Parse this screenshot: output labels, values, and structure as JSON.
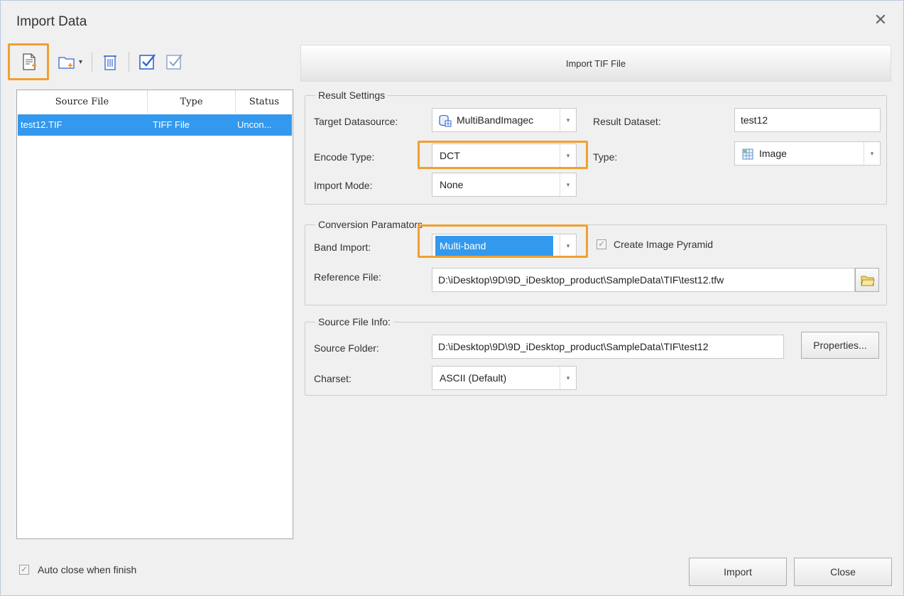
{
  "window": {
    "title": "Import Data",
    "close_glyph": "✕"
  },
  "toolbar": {
    "items": [
      {
        "name": "add-file-icon"
      },
      {
        "name": "add-folder-icon"
      },
      {
        "name": "delete-icon"
      },
      {
        "name": "select-all-icon"
      },
      {
        "name": "invert-selection-icon"
      }
    ],
    "dropdown_glyph": "▾"
  },
  "file_list": {
    "columns": [
      "Source File",
      "Type",
      "Status"
    ],
    "rows": [
      {
        "source_file": "test12.TIF",
        "type": "TIFF File",
        "status": "Uncon..."
      }
    ]
  },
  "panel": {
    "header": "Import TIF File"
  },
  "result_settings": {
    "legend": "Result Settings",
    "target_datasource_label": "Target Datasource:",
    "target_datasource_value": "MultiBandImagec",
    "result_dataset_label": "Result Dataset:",
    "result_dataset_value": "test12",
    "encode_type_label": "Encode Type:",
    "encode_type_value": "DCT",
    "type_label": "Type:",
    "type_value": "Image",
    "import_mode_label": "Import Mode:",
    "import_mode_value": "None"
  },
  "conversion": {
    "legend": "Conversion Paramators",
    "band_import_label": "Band Import:",
    "band_import_value": "Multi-band",
    "create_pyramid_label": "Create Image Pyramid",
    "create_pyramid_checked": true,
    "reference_file_label": "Reference File:",
    "reference_file_value": "D:\\iDesktop\\9D\\9D_iDesktop_product\\SampleData\\TIF\\test12.tfw"
  },
  "source_info": {
    "legend": "Source File Info:",
    "source_folder_label": "Source Folder:",
    "source_folder_value": "D:\\iDesktop\\9D\\9D_iDesktop_product\\SampleData\\TIF\\test12",
    "properties_button": "Properties...",
    "charset_label": "Charset:",
    "charset_value": "ASCII (Default)"
  },
  "footer": {
    "auto_close_label": "Auto close when finish",
    "auto_close_checked": true,
    "import_button": "Import",
    "close_button": "Close"
  },
  "colors": {
    "highlight": "#f0a030",
    "selection": "#3399ee",
    "accent": "#3366cc"
  }
}
